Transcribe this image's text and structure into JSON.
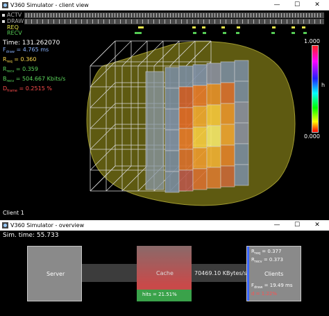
{
  "client_window": {
    "title": "V360 Simulator - client view",
    "legend": [
      {
        "label": "ACTV",
        "color": "#a8a8a8"
      },
      {
        "label": "DRAW",
        "color": "#a8a8a8"
      },
      {
        "label": "REQ",
        "color": "#e6e64c"
      },
      {
        "label": "RECV",
        "color": "#55cc55"
      }
    ],
    "time_label": "Time: 131.262070",
    "stats": [
      {
        "symbol": "F",
        "sub": "draw",
        "text": " = 4.765 ms",
        "color": "#8ab4ff"
      },
      {
        "symbol": "R",
        "sub": "req",
        "text": " = 0.360",
        "color": "#ffdb4d"
      },
      {
        "symbol": "R",
        "sub": "recv",
        "text": " = 0.359",
        "color": "#5cd65c"
      },
      {
        "symbol": "B",
        "sub": "recv",
        "text": " = 504.667 Kbits/s",
        "color": "#5cd65c"
      },
      {
        "symbol": "D",
        "sub": "frame",
        "text": " = 0.2515 %",
        "color": "#ff4d4d"
      }
    ],
    "colorbar": {
      "max": "1.000",
      "min": "0.000",
      "axis_label": "h"
    },
    "client_label": "Client 1",
    "req_marks": [
      0.382,
      0.388,
      0.563,
      0.595,
      0.66,
      0.712,
      0.83,
      0.895,
      0.93
    ],
    "recv_marks": [
      0.37,
      0.376,
      0.382,
      0.565,
      0.598,
      0.665,
      0.71,
      0.828,
      0.895,
      0.935
    ]
  },
  "overview_window": {
    "title": "V360 Simulator - overview",
    "sim_time": "Sim. time: 55.733",
    "server_label": "Server",
    "cache_label": "Cache",
    "hits_label": "hits = 21.51%",
    "hits_fraction": 0.2151,
    "bandwidth": "70469.10 KBytes/s",
    "clients_label": "Clients",
    "clients_stats": [
      {
        "symbol": "R",
        "sub": "req",
        "text": " = 0.377",
        "color": "#ffffff"
      },
      {
        "symbol": "R",
        "sub": "recv",
        "text": " = 0.373",
        "color": "#ffffff"
      },
      {
        "symbol": "F",
        "sub": "draw",
        "text": " = 19.49 ms",
        "color": "#ffffff"
      },
      {
        "symbol": "d",
        "sub": "",
        "text": " = 1.22%",
        "color": "#ff5050"
      }
    ]
  },
  "icons": {
    "minimize": "minimize-icon",
    "maximize": "maximize-icon",
    "close": "close-icon",
    "app": "app-icon"
  }
}
